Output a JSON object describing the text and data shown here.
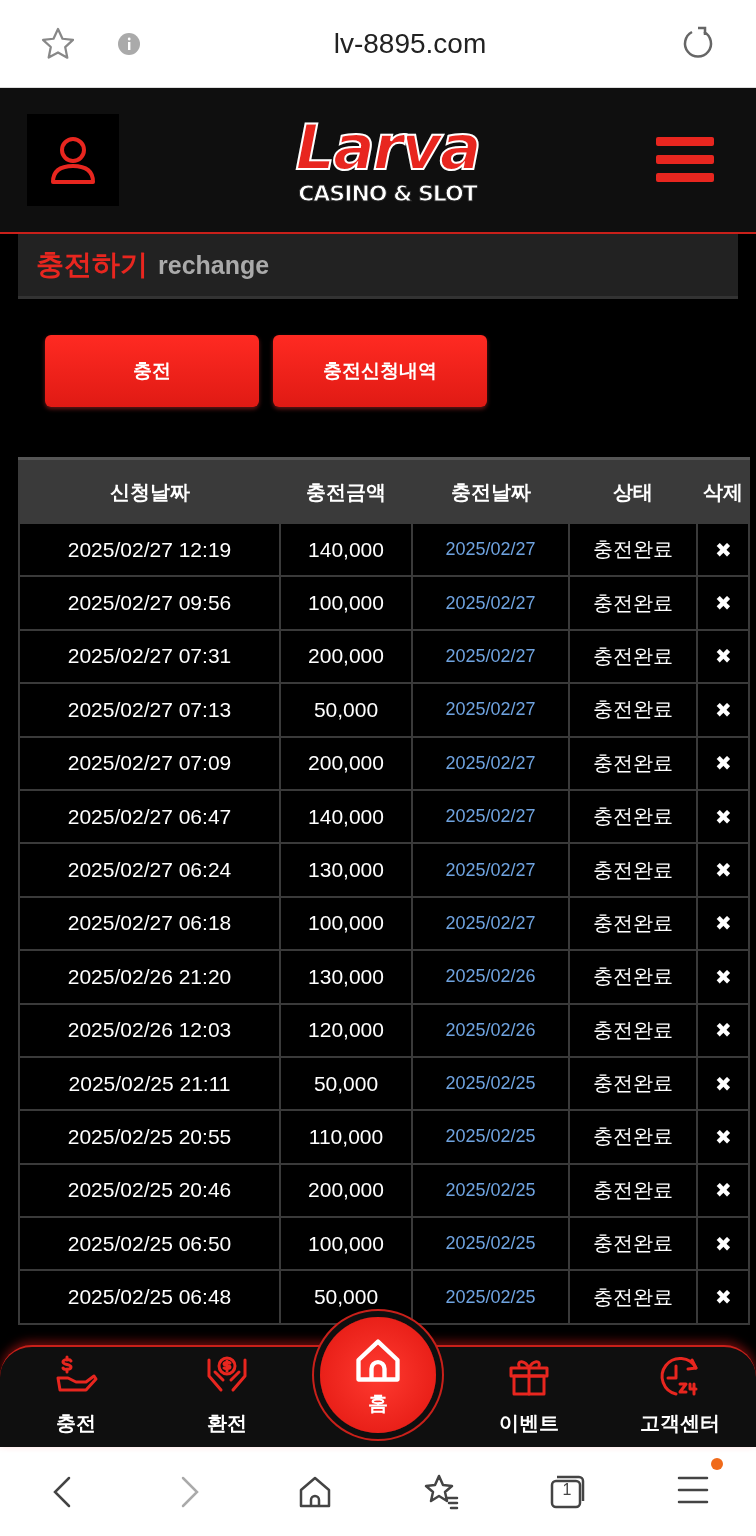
{
  "browser_bar": {
    "url": "lv-8895.com"
  },
  "header": {
    "logo": {
      "name": "Larva",
      "tagline": "CASINO & SLOT"
    }
  },
  "section": {
    "title": "충전하기",
    "subtitle": "rechange"
  },
  "buttons": [
    {
      "label": "충전"
    },
    {
      "label": "충전신청내역"
    }
  ],
  "table": {
    "columns": [
      "신청날짜",
      "충전금액",
      "충전날짜",
      "상태",
      "삭제"
    ],
    "rows": [
      {
        "requested": "2025/02/27 12:19",
        "amount": "140,000",
        "charged": "2025/02/27",
        "status": "충전완료",
        "delete": "✖"
      },
      {
        "requested": "2025/02/27 09:56",
        "amount": "100,000",
        "charged": "2025/02/27",
        "status": "충전완료",
        "delete": "✖"
      },
      {
        "requested": "2025/02/27 07:31",
        "amount": "200,000",
        "charged": "2025/02/27",
        "status": "충전완료",
        "delete": "✖"
      },
      {
        "requested": "2025/02/27 07:13",
        "amount": "50,000",
        "charged": "2025/02/27",
        "status": "충전완료",
        "delete": "✖"
      },
      {
        "requested": "2025/02/27 07:09",
        "amount": "200,000",
        "charged": "2025/02/27",
        "status": "충전완료",
        "delete": "✖"
      },
      {
        "requested": "2025/02/27 06:47",
        "amount": "140,000",
        "charged": "2025/02/27",
        "status": "충전완료",
        "delete": "✖"
      },
      {
        "requested": "2025/02/27 06:24",
        "amount": "130,000",
        "charged": "2025/02/27",
        "status": "충전완료",
        "delete": "✖"
      },
      {
        "requested": "2025/02/27 06:18",
        "amount": "100,000",
        "charged": "2025/02/27",
        "status": "충전완료",
        "delete": "✖"
      },
      {
        "requested": "2025/02/26 21:20",
        "amount": "130,000",
        "charged": "2025/02/26",
        "status": "충전완료",
        "delete": "✖"
      },
      {
        "requested": "2025/02/26 12:03",
        "amount": "120,000",
        "charged": "2025/02/26",
        "status": "충전완료",
        "delete": "✖"
      },
      {
        "requested": "2025/02/25 21:11",
        "amount": "50,000",
        "charged": "2025/02/25",
        "status": "충전완료",
        "delete": "✖"
      },
      {
        "requested": "2025/02/25 20:55",
        "amount": "110,000",
        "charged": "2025/02/25",
        "status": "충전완료",
        "delete": "✖"
      },
      {
        "requested": "2025/02/25 20:46",
        "amount": "200,000",
        "charged": "2025/02/25",
        "status": "충전완료",
        "delete": "✖"
      },
      {
        "requested": "2025/02/25 06:50",
        "amount": "100,000",
        "charged": "2025/02/25",
        "status": "충전완료",
        "delete": "✖"
      },
      {
        "requested": "2025/02/25 06:48",
        "amount": "50,000",
        "charged": "2025/02/25",
        "status": "충전완료",
        "delete": "✖"
      }
    ]
  },
  "bottom_nav": [
    {
      "kind": "deposit",
      "label": "충전"
    },
    {
      "kind": "withdraw",
      "label": "환전"
    },
    {
      "kind": "home",
      "label": "홈"
    },
    {
      "kind": "event",
      "label": "이벤트"
    },
    {
      "kind": "support",
      "label": "고객센터"
    }
  ],
  "browser_toolbar": {
    "tab_count": "1",
    "menu_badge": true
  }
}
